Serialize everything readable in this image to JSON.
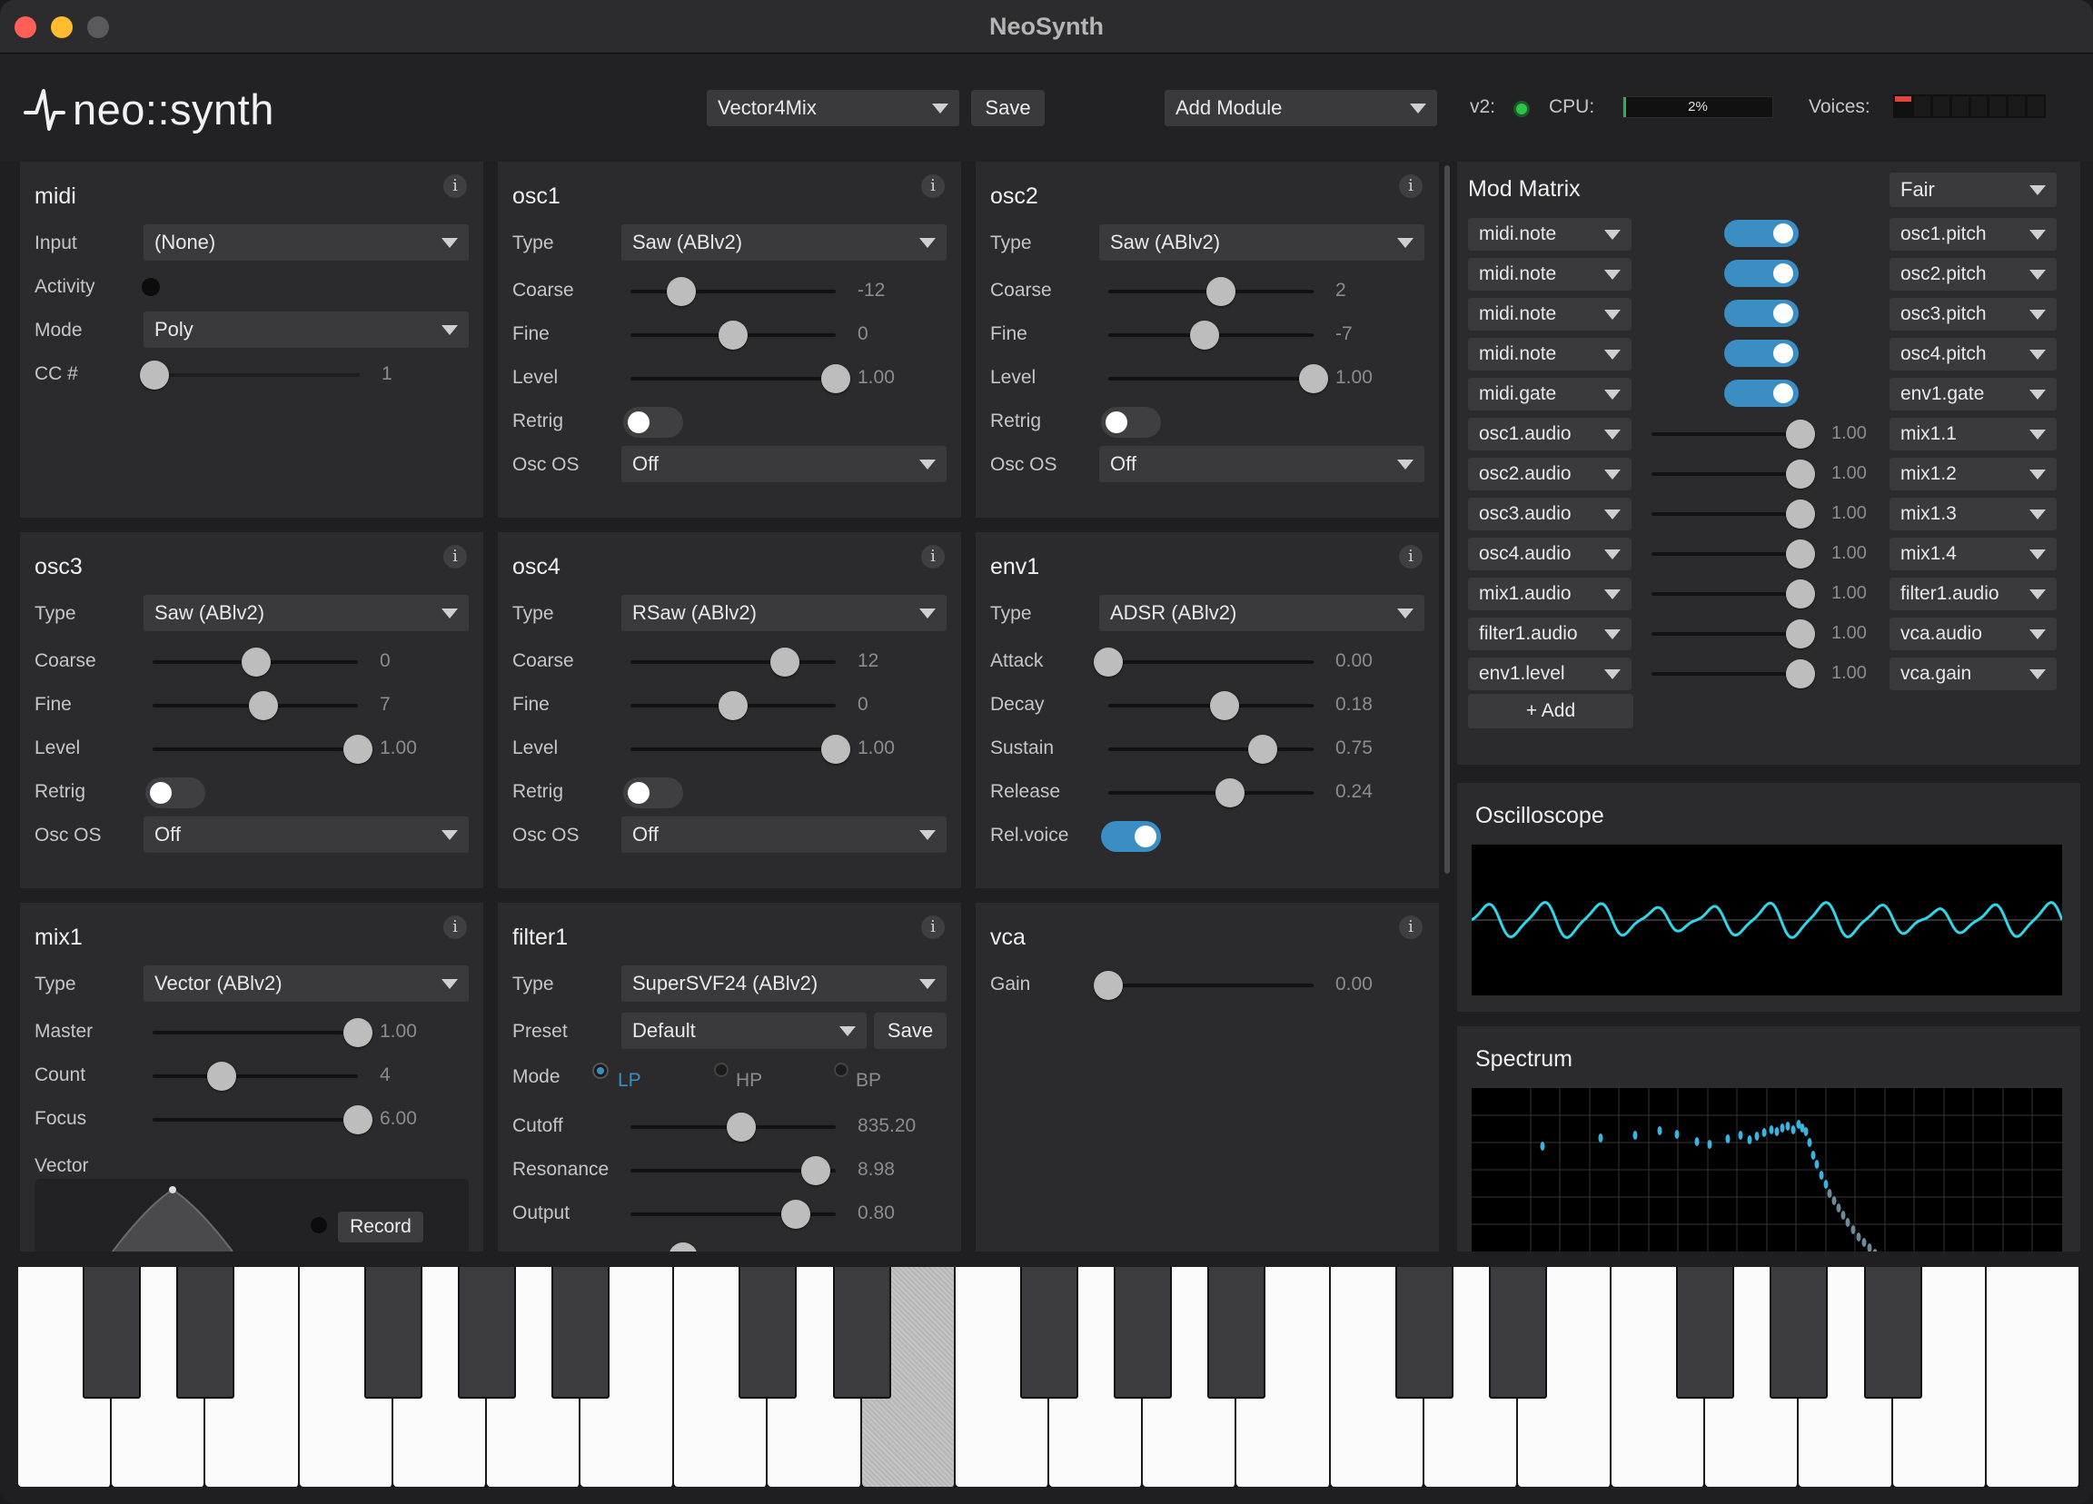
{
  "window": {
    "title": "NeoSynth"
  },
  "header": {
    "logo": "neo::synth",
    "preset": "Vector4Mix",
    "save": "Save",
    "add_module": "Add Module",
    "version_label": "v2:",
    "cpu_label": "CPU:",
    "cpu_value": "2%",
    "cpu_percent": 2,
    "voices_label": "Voices:"
  },
  "midi": {
    "title": "midi",
    "input_label": "Input",
    "input_value": "(None)",
    "activity_label": "Activity",
    "mode_label": "Mode",
    "mode_value": "Poly",
    "cc_label": "CC #",
    "cc_value": "1"
  },
  "osc1": {
    "title": "osc1",
    "type_label": "Type",
    "type_value": "Saw (ABlv2)",
    "coarse_label": "Coarse",
    "coarse_value": "-12",
    "fine_label": "Fine",
    "fine_value": "0",
    "level_label": "Level",
    "level_value": "1.00",
    "retrig_label": "Retrig",
    "oscos_label": "Osc OS",
    "oscos_value": "Off"
  },
  "osc2": {
    "title": "osc2",
    "type_label": "Type",
    "type_value": "Saw (ABlv2)",
    "coarse_label": "Coarse",
    "coarse_value": "2",
    "fine_label": "Fine",
    "fine_value": "-7",
    "level_label": "Level",
    "level_value": "1.00",
    "retrig_label": "Retrig",
    "oscos_label": "Osc OS",
    "oscos_value": "Off"
  },
  "osc3": {
    "title": "osc3",
    "type_label": "Type",
    "type_value": "Saw (ABlv2)",
    "coarse_label": "Coarse",
    "coarse_value": "0",
    "fine_label": "Fine",
    "fine_value": "7",
    "level_label": "Level",
    "level_value": "1.00",
    "retrig_label": "Retrig",
    "oscos_label": "Osc OS",
    "oscos_value": "Off"
  },
  "osc4": {
    "title": "osc4",
    "type_label": "Type",
    "type_value": "RSaw (ABlv2)",
    "coarse_label": "Coarse",
    "coarse_value": "12",
    "fine_label": "Fine",
    "fine_value": "0",
    "level_label": "Level",
    "level_value": "1.00",
    "retrig_label": "Retrig",
    "oscos_label": "Osc OS",
    "oscos_value": "Off"
  },
  "env1": {
    "title": "env1",
    "type_label": "Type",
    "type_value": "ADSR (ABlv2)",
    "attack_label": "Attack",
    "attack_value": "0.00",
    "decay_label": "Decay",
    "decay_value": "0.18",
    "sustain_label": "Sustain",
    "sustain_value": "0.75",
    "release_label": "Release",
    "release_value": "0.24",
    "relvoice_label": "Rel.voice"
  },
  "mix1": {
    "title": "mix1",
    "type_label": "Type",
    "type_value": "Vector (ABlv2)",
    "master_label": "Master",
    "master_value": "1.00",
    "count_label": "Count",
    "count_value": "4",
    "focus_label": "Focus",
    "focus_value": "6.00",
    "vector_label": "Vector",
    "record": "Record"
  },
  "filter1": {
    "title": "filter1",
    "type_label": "Type",
    "type_value": "SuperSVF24 (ABlv2)",
    "preset_label": "Preset",
    "preset_value": "Default",
    "save": "Save",
    "mode_label": "Mode",
    "mode_lp": "LP",
    "mode_hp": "HP",
    "mode_bp": "BP",
    "cutoff_label": "Cutoff",
    "cutoff_value": "835.20",
    "resonance_label": "Resonance",
    "resonance_value": "8.98",
    "output_label": "Output",
    "output_value": "0.80"
  },
  "vca": {
    "title": "vca",
    "gain_label": "Gain",
    "gain_value": "0.00"
  },
  "modmatrix": {
    "title": "Mod Matrix",
    "quality": "Fair",
    "add": "+ Add",
    "rows": [
      {
        "src": "midi.note",
        "amt": "",
        "dst": "osc1.pitch"
      },
      {
        "src": "midi.note",
        "amt": "",
        "dst": "osc2.pitch"
      },
      {
        "src": "midi.note",
        "amt": "",
        "dst": "osc3.pitch"
      },
      {
        "src": "midi.note",
        "amt": "",
        "dst": "osc4.pitch"
      },
      {
        "src": "midi.gate",
        "amt": "",
        "dst": "env1.gate"
      },
      {
        "src": "osc1.audio",
        "amt": "1.00",
        "dst": "mix1.1"
      },
      {
        "src": "osc2.audio",
        "amt": "1.00",
        "dst": "mix1.2"
      },
      {
        "src": "osc3.audio",
        "amt": "1.00",
        "dst": "mix1.3"
      },
      {
        "src": "osc4.audio",
        "amt": "1.00",
        "dst": "mix1.4"
      },
      {
        "src": "mix1.audio",
        "amt": "1.00",
        "dst": "filter1.audio"
      },
      {
        "src": "filter1.audio",
        "amt": "1.00",
        "dst": "vca.audio"
      },
      {
        "src": "env1.level",
        "amt": "1.00",
        "dst": "vca.gain"
      }
    ]
  },
  "oscilloscope": {
    "title": "Oscilloscope"
  },
  "spectrum": {
    "title": "Spectrum"
  },
  "colors": {
    "accent": "#3a8ec4",
    "scope_wave": "#2fd6ea",
    "panel": "#2b2b2d",
    "background": "#1f1f21"
  }
}
